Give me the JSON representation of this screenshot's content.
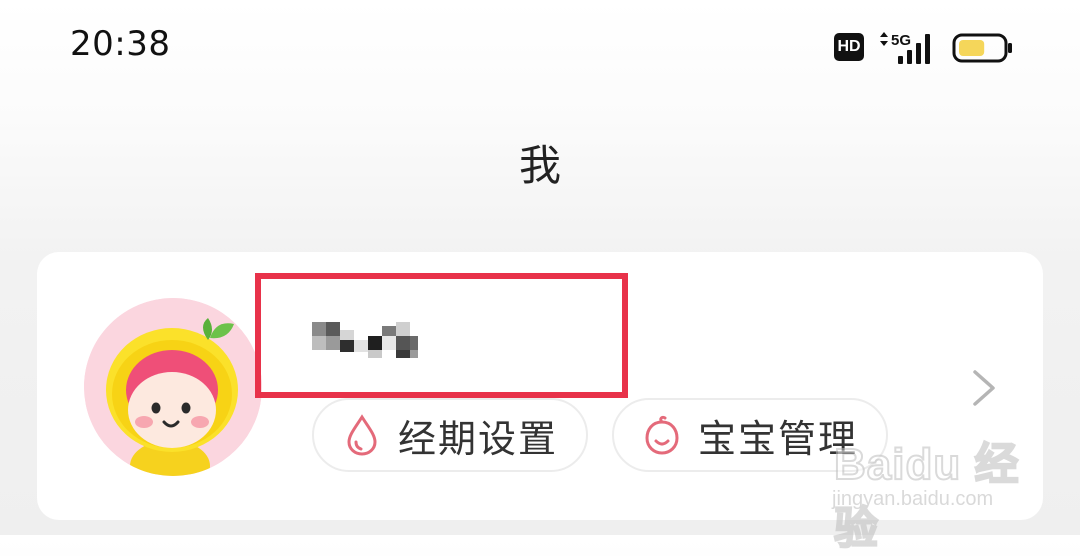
{
  "status_bar": {
    "time": "20:38",
    "hd_badge": "HD",
    "network_label": "5G",
    "battery_level": 0.6,
    "battery_color": "#f5d65a"
  },
  "header": {
    "title": "我"
  },
  "profile": {
    "nickname": "",
    "nickname_obscured": true,
    "highlight_color": "#e8324a",
    "avatar_bg": "#fbd6df"
  },
  "actions": [
    {
      "label": "经期设置",
      "icon": "droplet-icon"
    },
    {
      "label": "宝宝管理",
      "icon": "baby-face-icon"
    }
  ],
  "accent_color": "#e46a7a",
  "watermark": {
    "logo": "Baidu 经验",
    "url": "jingyan.baidu.com"
  }
}
